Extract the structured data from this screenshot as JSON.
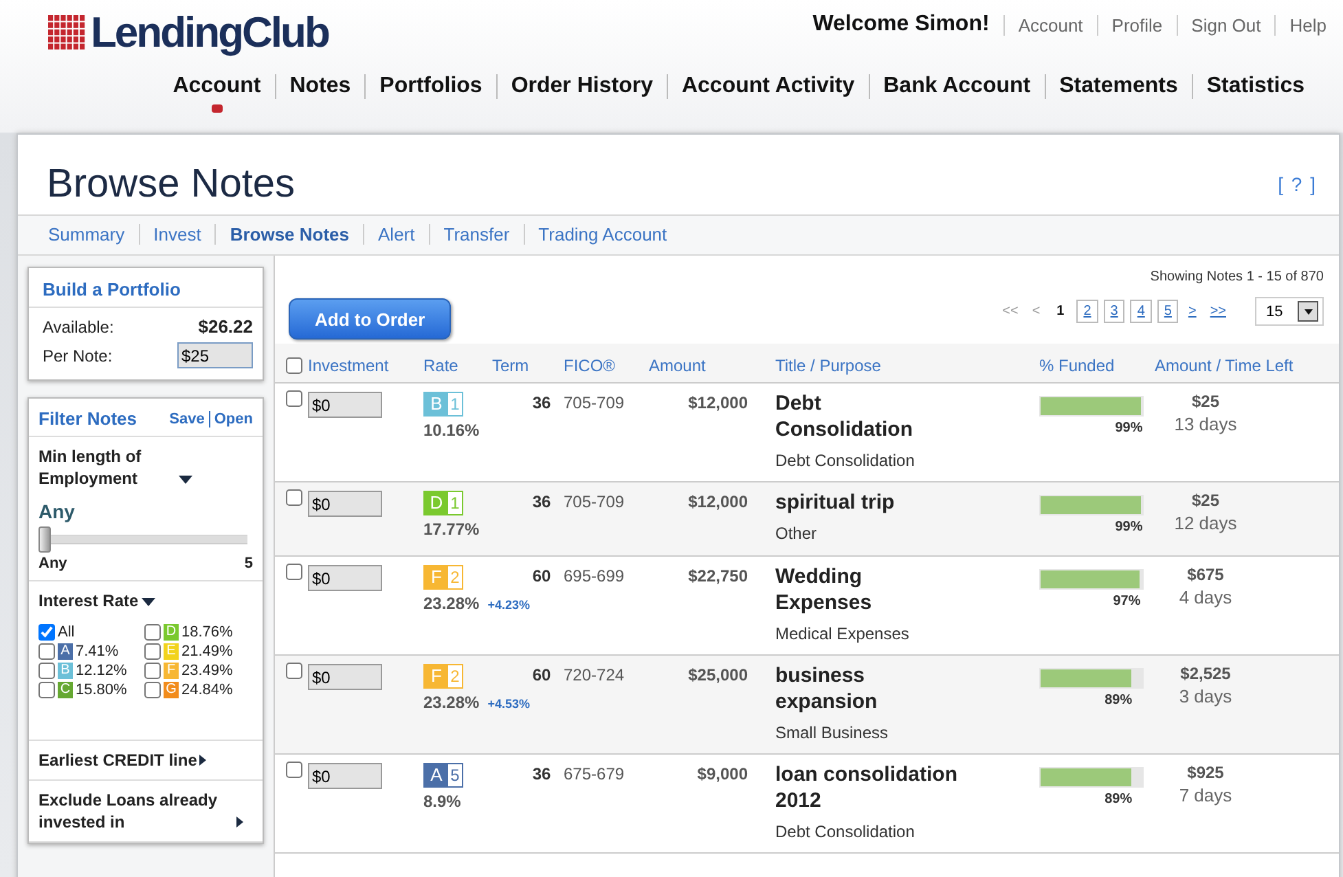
{
  "logo": {
    "text": "LendingClub"
  },
  "welcome": "Welcome Simon!",
  "user_links": [
    "Account",
    "Profile",
    "Sign Out",
    "Help"
  ],
  "main_nav": [
    {
      "label": "Account",
      "selected": true
    },
    {
      "label": "Notes",
      "selected": false
    },
    {
      "label": "Portfolios",
      "selected": false
    },
    {
      "label": "Order History",
      "selected": false
    },
    {
      "label": "Account Activity",
      "selected": false
    },
    {
      "label": "Bank Account",
      "selected": false
    },
    {
      "label": "Statements",
      "selected": false
    },
    {
      "label": "Statistics",
      "selected": false
    }
  ],
  "page_title": "Browse Notes",
  "help_link": "[ ? ]",
  "sub_nav": [
    {
      "label": "Summary",
      "selected": false
    },
    {
      "label": "Invest",
      "selected": false
    },
    {
      "label": "Browse Notes",
      "selected": true
    },
    {
      "label": "Alert",
      "selected": false
    },
    {
      "label": "Transfer",
      "selected": false
    },
    {
      "label": "Trading Account",
      "selected": false
    }
  ],
  "portfolio": {
    "title": "Build a Portfolio",
    "available_label": "Available:",
    "available_value": "$26.22",
    "per_note_label": "Per Note:",
    "per_note_value": "$25"
  },
  "filters": {
    "title": "Filter Notes",
    "actions": [
      "Save",
      "Open"
    ],
    "employment": {
      "label": "Min length of Employment",
      "value": "Any",
      "level": 0,
      "min_label": "Any",
      "max_label": "5"
    },
    "interest_rate": {
      "label": "Interest Rate",
      "options": [
        {
          "label": "All",
          "checked": true
        },
        {
          "grade": "D",
          "color": "#7ac92e",
          "label": "18.76%",
          "checked": false
        },
        {
          "grade": "A",
          "color": "#4b6fa8",
          "label": "7.41%",
          "checked": false
        },
        {
          "grade": "E",
          "color": "#f2d31c",
          "label": "21.49%",
          "checked": false
        },
        {
          "grade": "B",
          "color": "#6cc0d8",
          "label": "12.12%",
          "checked": false
        },
        {
          "grade": "F",
          "color": "#f7b733",
          "label": "23.49%",
          "checked": false
        },
        {
          "grade": "C",
          "color": "#66a832",
          "label": "15.80%",
          "checked": false
        },
        {
          "grade": "G",
          "color": "#f28c1c",
          "label": "24.84%",
          "checked": false
        }
      ]
    },
    "collapsed": [
      "Earliest CREDIT line",
      "Exclude Loans already invested in"
    ]
  },
  "add_button": "Add to Order",
  "results": "Showing Notes 1 - 15 of 870",
  "pagination": {
    "first": "<<",
    "prev": "<",
    "pages": [
      {
        "label": "1",
        "selected": true
      },
      {
        "label": "2",
        "selected": false
      },
      {
        "label": "3",
        "selected": false
      },
      {
        "label": "4",
        "selected": false
      },
      {
        "label": "5",
        "selected": false
      }
    ],
    "next": ">",
    "last": ">>",
    "per_page": "15"
  },
  "select_all": {
    "checked": false
  },
  "columns": [
    "Investment",
    "Rate",
    "Term",
    "FICO®",
    "Amount",
    "Title / Purpose",
    "% Funded",
    "Amount / Time Left"
  ],
  "rows": [
    {
      "checked": false,
      "investment": "$0",
      "grade": "B",
      "subgrade": "1",
      "color": "#6cc0d8",
      "rate": "10.16%",
      "term": "36",
      "fico": "705-709",
      "amount": "$12,000",
      "title": "Debt Consolidation",
      "purpose": "Debt Consolidation",
      "level": 0.99,
      "funded": "99%",
      "amount_left": "$25",
      "time_left": "13 days"
    },
    {
      "checked": false,
      "investment": "$0",
      "grade": "D",
      "subgrade": "1",
      "color": "#7ac92e",
      "rate": "17.77%",
      "term": "36",
      "fico": "705-709",
      "amount": "$12,000",
      "title": "spiritual trip",
      "purpose": "Other",
      "level": 0.99,
      "funded": "99%",
      "amount_left": "$25",
      "time_left": "12 days"
    },
    {
      "checked": false,
      "investment": "$0",
      "grade": "F",
      "subgrade": "2",
      "color": "#f7b733",
      "rate": "23.28%",
      "rate_bonus": "+4.23%",
      "term": "60",
      "fico": "695-699",
      "amount": "$22,750",
      "title": "Wedding Expenses",
      "purpose": "Medical Expenses",
      "level": 0.97,
      "funded": "97%",
      "amount_left": "$675",
      "time_left": "4 days"
    },
    {
      "checked": false,
      "investment": "$0",
      "grade": "F",
      "subgrade": "2",
      "color": "#f7b733",
      "rate": "23.28%",
      "rate_bonus": "+4.53%",
      "term": "60",
      "fico": "720-724",
      "amount": "$25,000",
      "title": "business expansion",
      "purpose": "Small Business",
      "level": 0.89,
      "funded": "89%",
      "amount_left": "$2,525",
      "time_left": "3 days"
    },
    {
      "checked": false,
      "investment": "$0",
      "grade": "A",
      "subgrade": "5",
      "color": "#4b6fa8",
      "rate": "8.9%",
      "term": "36",
      "fico": "675-679",
      "amount": "$9,000",
      "title": "loan consolidation 2012",
      "purpose": "Debt Consolidation",
      "level": 0.89,
      "funded": "89%",
      "amount_left": "$925",
      "time_left": "7 days"
    }
  ]
}
